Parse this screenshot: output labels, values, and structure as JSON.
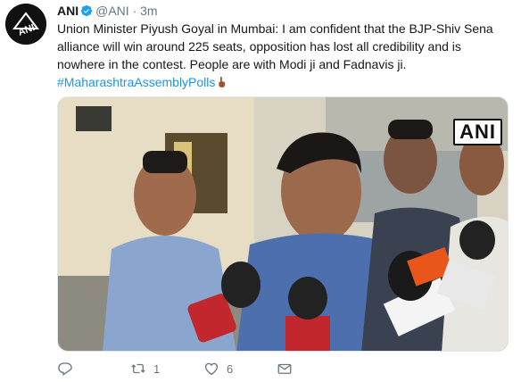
{
  "tweet": {
    "author_name": "ANI",
    "handle": "@ANI",
    "separator": "·",
    "time": "3m",
    "text": "Union Minister Piyush Goyal in Mumbai: I am confident that the BJP-Shiv Sena alliance will win around 225 seats, opposition has lost all credibility and is nowhere in the contest. People are with Modi ji and Fadnavis ji.",
    "hashtag": "#MaharashtraAssemblyPolls",
    "emoji": "pointing-finger-emoji",
    "media_watermark": "ANI",
    "avatar_logo": "ANI"
  },
  "actions": {
    "reply_icon": "reply-icon",
    "retweet_icon": "retweet-icon",
    "retweet_count": "1",
    "like_icon": "heart-icon",
    "like_count": "6",
    "dm_icon": "envelope-icon"
  },
  "colors": {
    "link": "#1b95e0",
    "verified": "#1da1f2",
    "muted": "#657786",
    "text": "#14171a"
  }
}
